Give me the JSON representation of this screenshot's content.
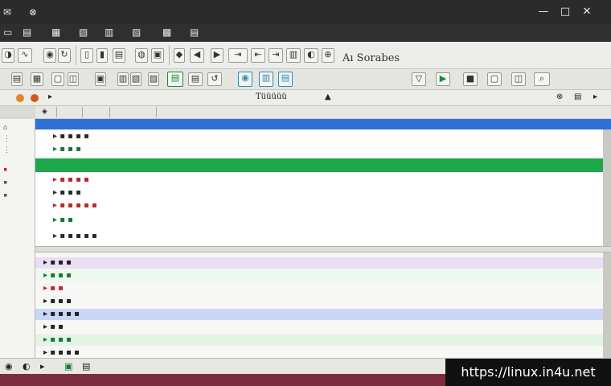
{
  "accent": "#2f6fd6",
  "highlight": "#1ea64b",
  "toolbar": {
    "search_label": "Aı Sorabes"
  },
  "filter": {
    "label": "Tüüüüü"
  },
  "watermark": "https://linux.in4u.net"
}
